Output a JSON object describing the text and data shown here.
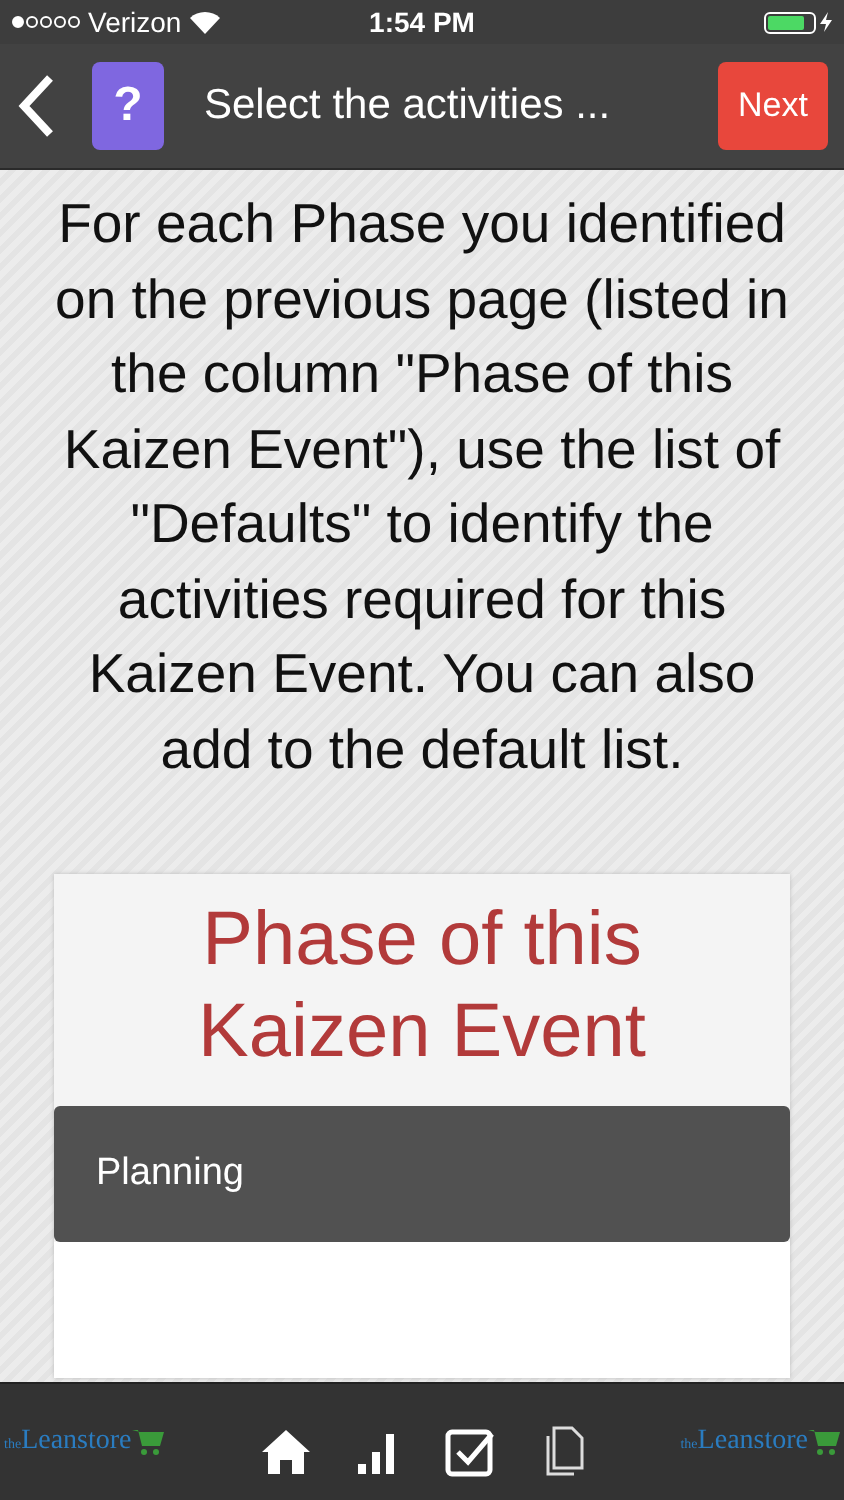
{
  "status_bar": {
    "carrier": "Verizon",
    "time": "1:54 PM",
    "battery": {
      "level": 0.8
    }
  },
  "nav": {
    "title": "Select the activities ...",
    "help": "?",
    "next": "Next"
  },
  "instructions": "For each Phase you identified on the previous page (listed in the column \"Phase of this Kaizen Event\"), use the list of \"Defaults\" to identify the activities required for this Kaizen Event. You can also add to the default list.",
  "card": {
    "title": "Phase of this Kaizen Event",
    "phases": [
      {
        "label": "Planning",
        "selected": true
      },
      {
        "selected": false
      }
    ]
  },
  "tab_bar": {
    "logo_left": {
      "small": "the",
      "name": "Leanstore"
    },
    "logo_right": {
      "small": "the",
      "name": "Leanstore"
    }
  }
}
